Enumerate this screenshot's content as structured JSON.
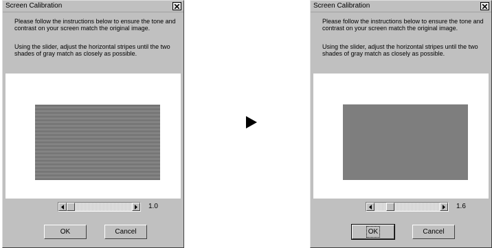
{
  "dialogs": [
    {
      "title": "Screen Calibration",
      "instruction_1": "Please follow the instructions below to ensure the tone and contrast on your screen match the original image.",
      "instruction_2": "Using the slider, adjust the horizontal stripes until the two shades of gray match as closely as possible.",
      "swatch": "striped",
      "slider_value": "1.0",
      "slider_position": 0.0,
      "ok_label": "OK",
      "cancel_label": "Cancel"
    },
    {
      "title": "Screen Calibration",
      "instruction_1": "Please follow the instructions below to ensure the tone and contrast on your screen match the original image.",
      "instruction_2": "Using the slider, adjust the horizontal stripes until the two shades of gray match as closely as possible.",
      "swatch": "solid",
      "slider_value": "1.6",
      "slider_position": 0.2,
      "ok_label": "OK",
      "cancel_label": "Cancel"
    }
  ],
  "icons": {
    "close": "close-icon",
    "left": "arrow-left-icon",
    "right": "arrow-right-icon",
    "transition": "play-arrow-icon"
  },
  "colors": {
    "dialog_face": "#c0c0c0",
    "swatch_gray": "#7e7e7e"
  }
}
